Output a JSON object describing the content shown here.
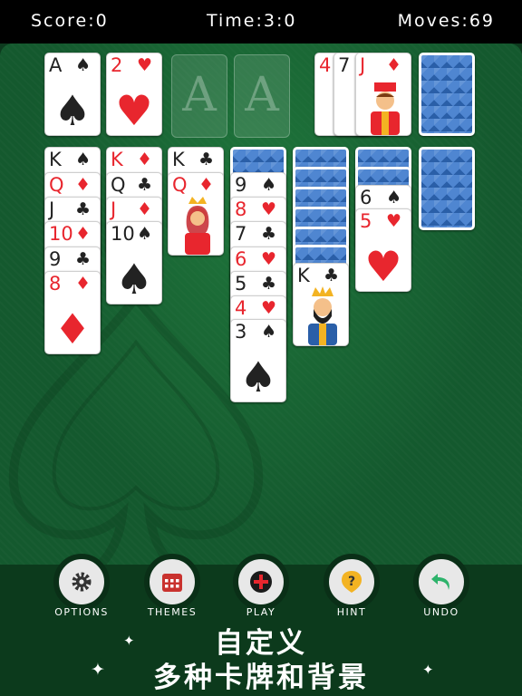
{
  "header": {
    "score": "Score:0",
    "time": "Time:3:0",
    "moves": "Moves:69"
  },
  "foundations": [
    {
      "rank": "A",
      "suit": "♠",
      "color": "black"
    },
    {
      "rank": "2",
      "suit": "♥",
      "color": "red"
    },
    {
      "empty": "A"
    },
    {
      "empty": "A"
    }
  ],
  "waste": [
    {
      "rank": "4",
      "suit": "♦",
      "color": "red"
    },
    {
      "rank": "7",
      "suit": "♠",
      "color": "black"
    },
    {
      "rank": "J",
      "suit": "♦",
      "color": "red",
      "face": true
    }
  ],
  "tableau": [
    [
      {
        "rank": "K",
        "suit": "♠",
        "color": "black"
      },
      {
        "rank": "Q",
        "suit": "♦",
        "color": "red"
      },
      {
        "rank": "J",
        "suit": "♣",
        "color": "black"
      },
      {
        "rank": "10",
        "suit": "♦",
        "color": "red"
      },
      {
        "rank": "9",
        "suit": "♣",
        "color": "black"
      },
      {
        "rank": "8",
        "suit": "♦",
        "color": "red"
      }
    ],
    [
      {
        "rank": "K",
        "suit": "♦",
        "color": "red"
      },
      {
        "rank": "Q",
        "suit": "♣",
        "color": "black"
      },
      {
        "rank": "J",
        "suit": "♦",
        "color": "red"
      },
      {
        "rank": "10",
        "suit": "♠",
        "color": "black"
      }
    ],
    [
      {
        "rank": "K",
        "suit": "♣",
        "color": "black"
      },
      {
        "rank": "Q",
        "suit": "♦",
        "color": "red",
        "face": true
      }
    ],
    [
      {
        "rank": "9",
        "suit": "♠",
        "color": "black"
      },
      {
        "rank": "8",
        "suit": "♥",
        "color": "red"
      },
      {
        "rank": "7",
        "suit": "♣",
        "color": "black"
      },
      {
        "rank": "6",
        "suit": "♥",
        "color": "red"
      },
      {
        "rank": "5",
        "suit": "♣",
        "color": "black"
      },
      {
        "rank": "4",
        "suit": "♥",
        "color": "red"
      },
      {
        "rank": "3",
        "suit": "♠",
        "color": "black"
      }
    ],
    [
      {
        "rank": "K",
        "suit": "♣",
        "color": "black",
        "face": true
      }
    ],
    [
      {
        "rank": "6",
        "suit": "♠",
        "color": "black"
      },
      {
        "rank": "5",
        "suit": "♥",
        "color": "red"
      }
    ]
  ],
  "toolbar": {
    "options": "OPTIONS",
    "themes": "THEMES",
    "play": "PLAY",
    "hint": "HINT",
    "undo": "UNDO"
  },
  "promo": {
    "line1": "自定义",
    "line2": "多种卡牌和背景"
  },
  "colors": {
    "felt": "#14592e",
    "card_back": "#4f86d1",
    "red_suit": "#e8262e",
    "toolbar_bg": "#0c3a1c"
  }
}
